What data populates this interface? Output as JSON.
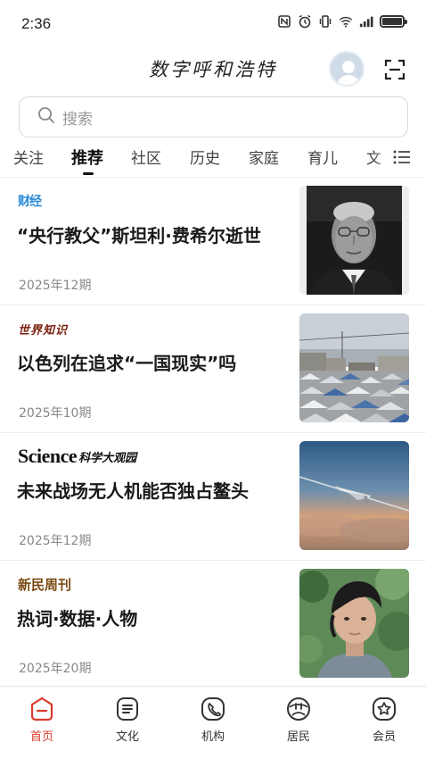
{
  "status_bar": {
    "time": "2:36"
  },
  "header": {
    "title": "数字呼和浩特"
  },
  "search": {
    "placeholder": "搜索"
  },
  "tabs": [
    {
      "label": "关注"
    },
    {
      "label": "推荐",
      "active": true
    },
    {
      "label": "社区"
    },
    {
      "label": "历史"
    },
    {
      "label": "家庭"
    },
    {
      "label": "育儿"
    },
    {
      "label": "文"
    }
  ],
  "articles": [
    {
      "source": "财经",
      "title": "“央行教父”斯坦利·费希尔逝世",
      "date": "2025年12期",
      "thumb": "portrait-elderly-man-bw"
    },
    {
      "source": "世界知识",
      "title": "以色列在追求“一国现实”吗",
      "date": "2025年10期",
      "thumb": "tent-camp"
    },
    {
      "source": "Science",
      "source_cn": "科学大观园",
      "title": "未来战场无人机能否独占鳌头",
      "date": "2025年12期",
      "thumb": "drone-in-sky"
    },
    {
      "source": "新民周刊",
      "title": "热词·数据·人物",
      "date": "2025年20期",
      "thumb": "portrait-young-man"
    }
  ],
  "bottom_nav": [
    {
      "label": "首页",
      "icon": "home-icon",
      "active": true
    },
    {
      "label": "文化",
      "icon": "culture-icon"
    },
    {
      "label": "机构",
      "icon": "institution-icon"
    },
    {
      "label": "居民",
      "icon": "resident-icon"
    },
    {
      "label": "会员",
      "icon": "member-icon"
    }
  ],
  "colors": {
    "accent": "#d93a2b",
    "text": "#1a1a1a",
    "muted": "#888888"
  }
}
